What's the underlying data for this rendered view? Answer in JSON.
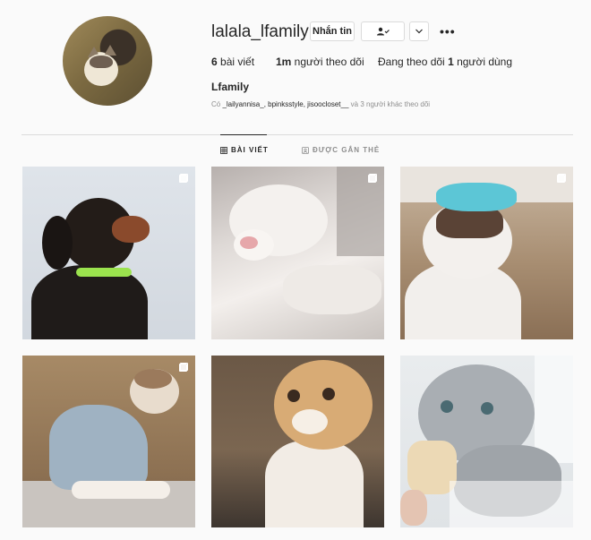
{
  "profile": {
    "username": "lalala_lfamily",
    "message_button": "Nhắn tin",
    "follow_icon": "person-check-icon",
    "chevron_icon": "chevron-down-icon",
    "more_icon": "more-horizontal-icon",
    "more_label": "•••",
    "full_name": "Lfamily"
  },
  "stats": {
    "posts_count": "6",
    "posts_label": " bài viết",
    "followers_count": "1m",
    "followers_label": " người theo dõi",
    "following_prefix": "Đang theo dõi ",
    "following_count": "1",
    "following_label": " người dùng"
  },
  "followed_by": {
    "prefix": "Có ",
    "names": "_lailyannisa_, bpinksstyle, jisoocloset__",
    "suffix": " và 3 người khác theo dõi"
  },
  "tabs": [
    {
      "label": "BÀI VIẾT",
      "icon": "grid-icon",
      "active": true
    },
    {
      "label": "ĐƯỢC GẮN THẺ",
      "icon": "tag-icon",
      "active": false
    }
  ],
  "posts": [
    {
      "subject": "dog",
      "icon": "multiple-photos-icon"
    },
    {
      "subject": "cat",
      "icon": "multiple-photos-icon"
    },
    {
      "subject": "cat",
      "icon": "multiple-photos-icon"
    },
    {
      "subject": "cat",
      "icon": "multiple-photos-icon"
    },
    {
      "subject": "cat",
      "icon": ""
    },
    {
      "subject": "cat",
      "icon": ""
    }
  ],
  "colors": {
    "text": "#262626",
    "secondary_text": "#8e8e8e",
    "border": "#dbdbdb",
    "background": "#fafafa"
  }
}
